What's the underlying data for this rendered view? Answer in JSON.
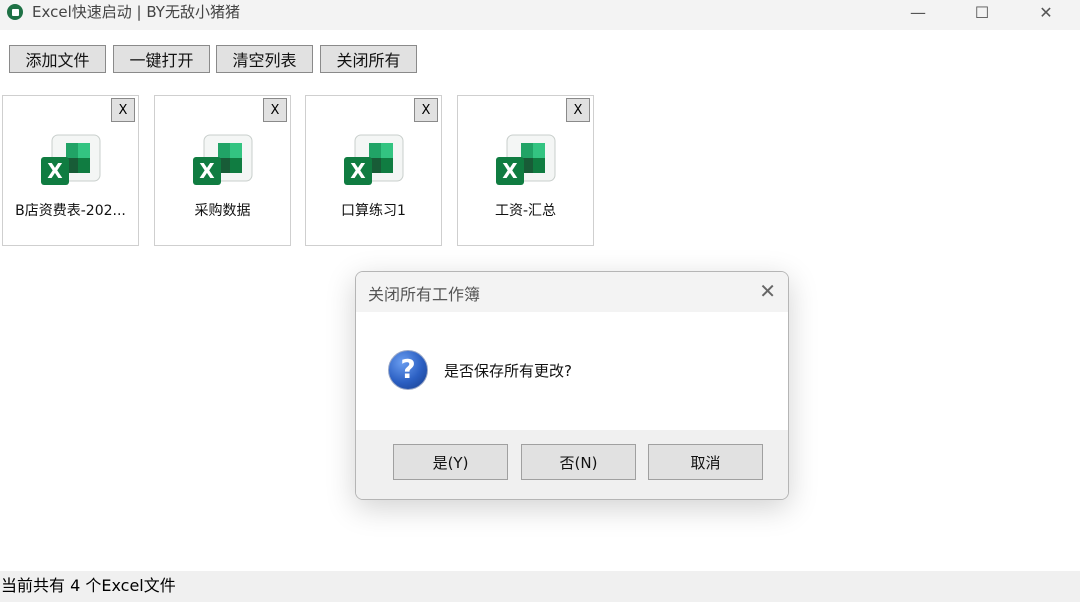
{
  "window": {
    "title": "Excel快速启动 | BY无敌小猪猪",
    "minimize_glyph": "—",
    "maximize_glyph": "☐",
    "close_glyph": "✕",
    "app_icon": "excel-app-icon"
  },
  "toolbar": {
    "add_label": "添加文件",
    "open_all_label": "一键打开",
    "clear_label": "清空列表",
    "close_all_label": "关闭所有"
  },
  "files": [
    {
      "name": "B店资费表-202...",
      "close_label": "X"
    },
    {
      "name": "采购数据",
      "close_label": "X"
    },
    {
      "name": "口算练习1",
      "close_label": "X"
    },
    {
      "name": "工资-汇总",
      "close_label": "X"
    }
  ],
  "status": {
    "text": "当前共有 4 个Excel文件"
  },
  "dialog": {
    "title": "关闭所有工作簿",
    "close_glyph": "✕",
    "icon": "question-icon",
    "icon_glyph": "?",
    "message": "是否保存所有更改?",
    "yes_label": "是(Y)",
    "no_label": "否(N)",
    "cancel_label": "取消"
  },
  "colors": {
    "excel_green_dark": "#107c41",
    "excel_green_light": "#33c481",
    "question_blue": "#2b5fc2"
  }
}
